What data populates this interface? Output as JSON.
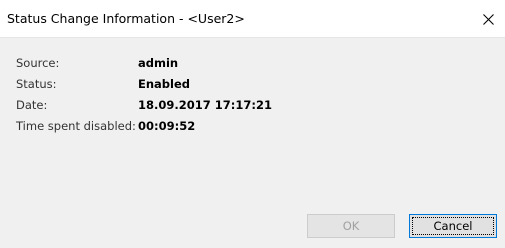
{
  "window": {
    "title": "Status Change Information - <User2>",
    "close_icon": "close-icon"
  },
  "info": {
    "rows": [
      {
        "label": "Source:",
        "value": "admin"
      },
      {
        "label": "Status:",
        "value": "Enabled"
      },
      {
        "label": "Date:",
        "value": "18.09.2017 17:17:21"
      },
      {
        "label": "Time spent disabled:",
        "value": "00:09:52"
      }
    ]
  },
  "buttons": {
    "ok_label": "OK",
    "ok_enabled": false,
    "cancel_label": "Cancel",
    "cancel_default": true
  },
  "colors": {
    "titlebar_bg": "#ffffff",
    "dialog_bg": "#f0f0f0",
    "default_button_border": "#0078d7"
  }
}
